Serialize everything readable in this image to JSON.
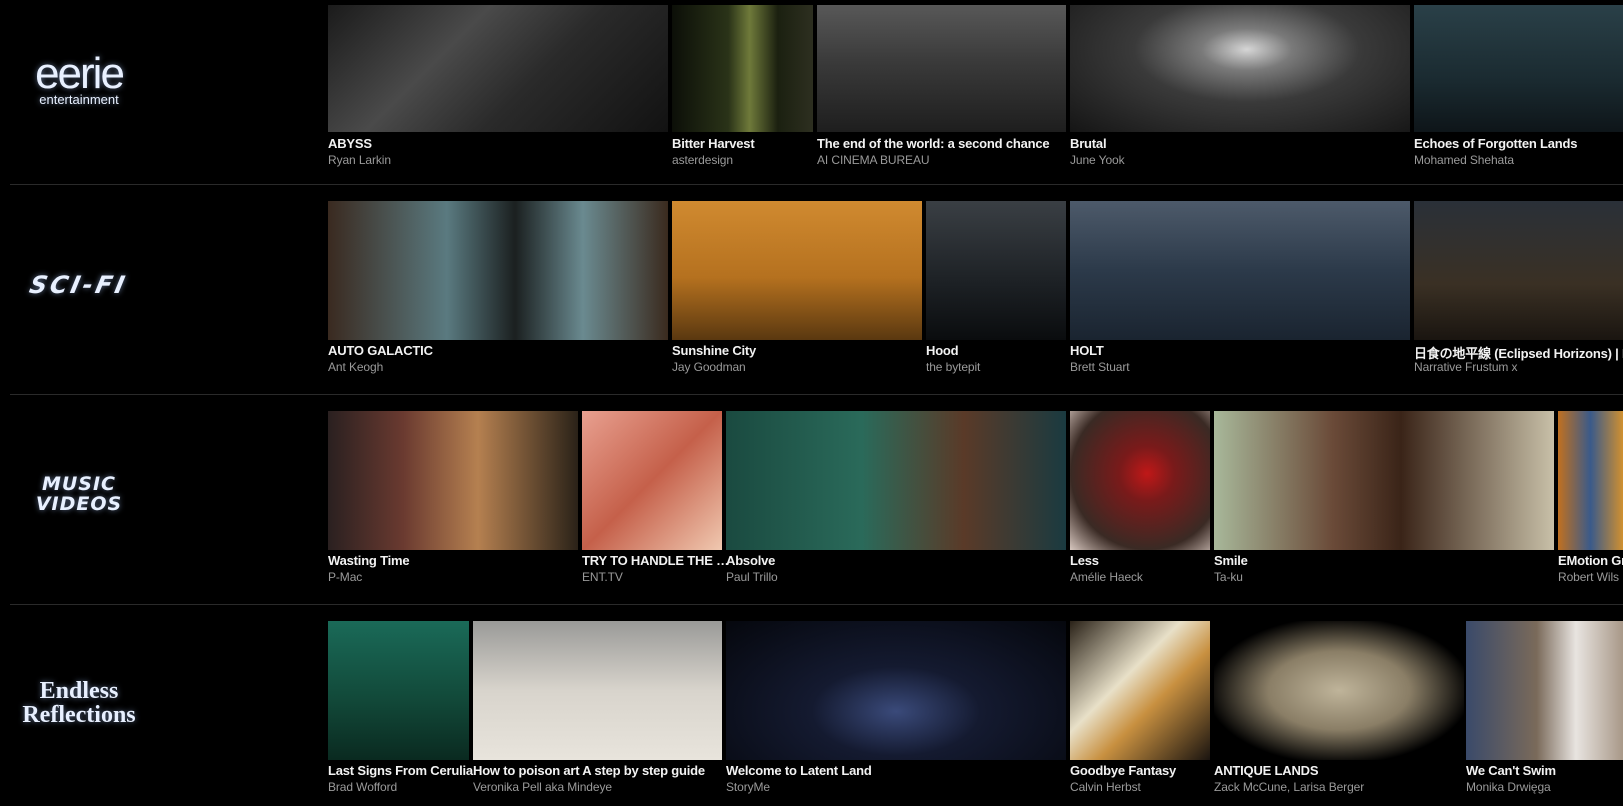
{
  "channels": [
    {
      "logo": {
        "main": "eerie",
        "sub": "entertainment"
      },
      "videos": [
        {
          "title": "ABYSS",
          "author": "Ryan Larkin",
          "bg": "linear-gradient(135deg,#1b1b1b 0%,#4a4a4a 35%,#2a2a2a 60%,#121212 100%)"
        },
        {
          "title": "Bitter Harvest",
          "author": "asterdesign",
          "bg": "linear-gradient(90deg,#0c0f08 0%,#2a3318 40%,#6f7a3a 55%,#1b2010 75%,#2d2f20 100%)"
        },
        {
          "title": "The end of the world: a second chance",
          "author": "AI CINEMA BUREAU",
          "bg": "linear-gradient(180deg,#585858 0%,#3a3a3a 45%,#1e1e1e 100%)"
        },
        {
          "title": "Brutal",
          "author": "June Yook",
          "bg": "radial-gradient(ellipse at 52% 35%,#d6d6d6 0%,#7a7a7a 18%,#3a3a3a 45%,#151515 100%)"
        },
        {
          "title": "Echoes of Forgotten Lands",
          "author": "Mohamed Shehata",
          "bg": "linear-gradient(180deg,#2a4048 0%,#1a2a30 60%,#0e1519 100%)"
        }
      ]
    },
    {
      "logo": {
        "main": "SCI-FI",
        "sub": ""
      },
      "videos": [
        {
          "title": "AUTO GALACTIC",
          "author": "Ant Keogh",
          "bg": "linear-gradient(90deg,#3a2a20 0%,#5a7a80 35%,#1b2020 55%,#6a8a90 75%,#3a2a1e 100%)"
        },
        {
          "title": "Sunshine City",
          "author": "Jay Goodman",
          "bg": "linear-gradient(180deg,#d08a30 0%,#b5711f 55%,#5a3810 100%)"
        },
        {
          "title": "Hood",
          "author": "the bytepit",
          "bg": "linear-gradient(180deg,#3a3f44 0%,#1c2024 60%,#0a0c0e 100%)"
        },
        {
          "title": "HOLT",
          "author": "Brett Stuart",
          "bg": "linear-gradient(180deg,#4d5a6a 0%,#2c3a4a 50%,#1a2430 100%)"
        },
        {
          "title": "日食の地平線 (Eclipsed Horizons) | El",
          "author": "Narrative Frustum x",
          "bg": "linear-gradient(180deg,#2a3038 0%,#3a3024 60%,#1a1510 100%)"
        }
      ]
    },
    {
      "logo": {
        "main": "MUSIC VIDEOS",
        "sub": ""
      },
      "videos": [
        {
          "title": "Wasting Time",
          "author": "P-Mac",
          "bg": "linear-gradient(90deg,#2a2020 0%,#6a3a30 30%,#b58050 60%,#2a2218 100%)"
        },
        {
          "title": "TRY TO HANDLE THE …",
          "author": "ENT.TV",
          "bg": "linear-gradient(135deg,#e8a090 0%,#c5604a 50%,#f0c8b0 100%)"
        },
        {
          "title": "Absolve",
          "author": "Paul Trillo",
          "bg": "linear-gradient(90deg,#1a4a40 0%,#2a6a5a 40%,#5a3a28 70%,#1a3a40 100%)"
        },
        {
          "title": "Less",
          "author": "Amélie Haeck",
          "bg": "radial-gradient(circle at 55% 45%,#c01818 0%,#7a1a1a 25%,#3a2a24 70%,#d8c8c0 100%)"
        },
        {
          "title": "Smile",
          "author": "Ta-ku",
          "bg": "linear-gradient(90deg,#a8b89a 0%,#6a4a38 35%,#3a2418 55%,#c8c0a8 100%)"
        },
        {
          "title": "EMotion Gr",
          "author": "Robert Wils",
          "bg": "linear-gradient(90deg,#c07020 0%,#3a5a8a 50%,#d09030 100%)"
        }
      ]
    },
    {
      "logo": {
        "main": "Endless",
        "sub": "Reflections"
      },
      "videos": [
        {
          "title": "Last Signs From Cerulia",
          "author": "Brad Wofford",
          "bg": "linear-gradient(180deg,#1a6a58 0%,#124a3a 55%,#0a2a20 100%)"
        },
        {
          "title": "How to poison art A step by step guide",
          "author": "Veronika Pell aka Mindeye",
          "bg": "linear-gradient(180deg,#9a9a98 0%,#d8d4cc 50%,#e8e4dc 100%)"
        },
        {
          "title": "Welcome to Latent Land",
          "author": "StoryMe",
          "bg": "radial-gradient(ellipse at 50% 65%,#3a4a7a 0%,#141a30 35%,#05070d 100%)"
        },
        {
          "title": "Goodbye Fantasy",
          "author": "Calvin Herbst",
          "bg": "linear-gradient(135deg,#2a2218 0%,#e8e0c8 40%,#c89040 60%,#1a1410 100%)"
        },
        {
          "title": "ANTIQUE LANDS",
          "author": "Zack McCune, Larisa Berger",
          "bg": "radial-gradient(ellipse at 50% 50%,#bfb49a 0%,#8a7e66 40%,#000 75%)"
        },
        {
          "title": "We Can't Swim",
          "author": "Monika Drwięga",
          "bg": "linear-gradient(90deg,#3a4a6a 0%,#7a6a5a 45%,#e8e4e0 70%,#a89888 100%)"
        }
      ]
    }
  ]
}
